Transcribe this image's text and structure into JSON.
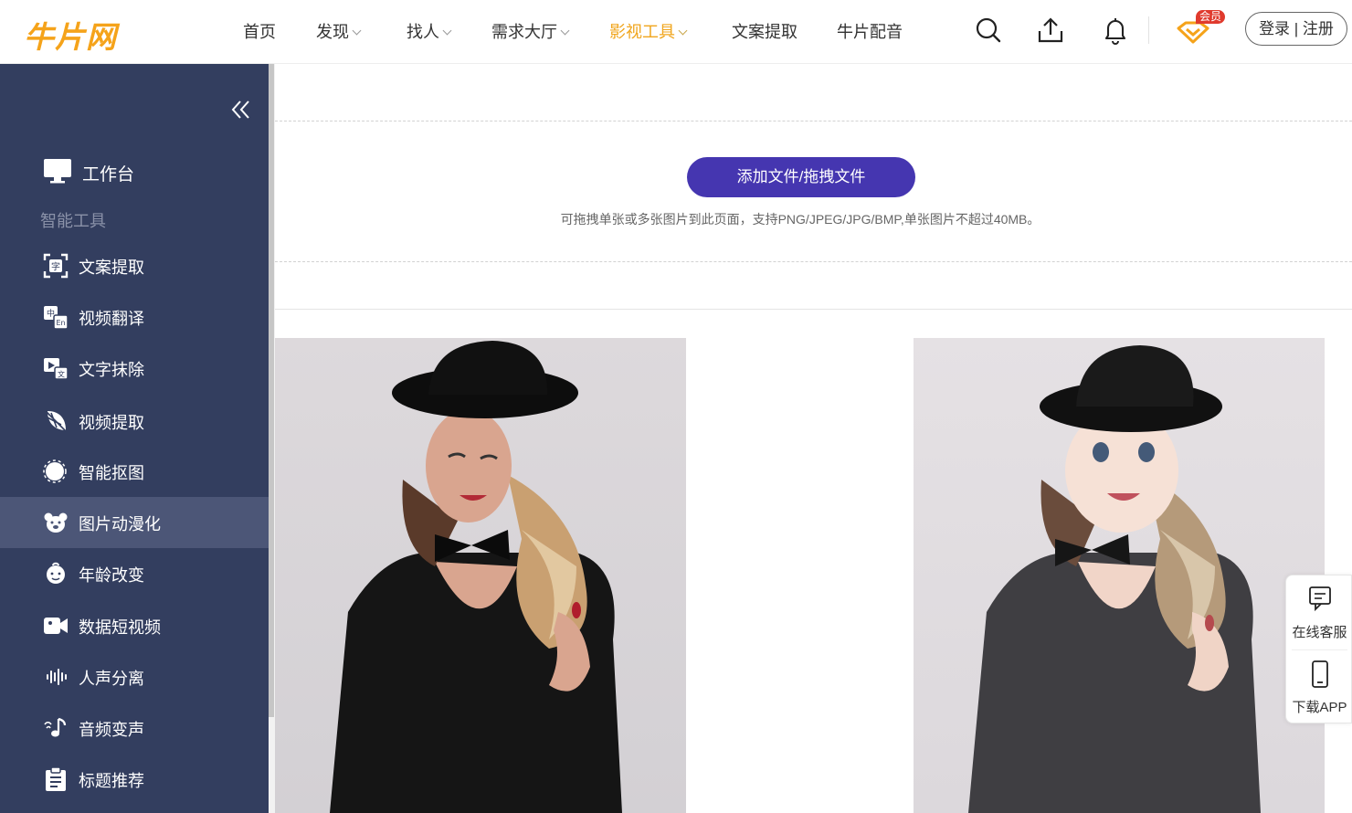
{
  "header": {
    "logo": "牛片网",
    "nav": [
      {
        "label": "首页",
        "dropdown": false,
        "active": false
      },
      {
        "label": "发现",
        "dropdown": true,
        "active": false
      },
      {
        "label": "找人",
        "dropdown": true,
        "active": false
      },
      {
        "label": "需求大厅",
        "dropdown": true,
        "active": false
      },
      {
        "label": "影视工具",
        "dropdown": true,
        "active": true
      },
      {
        "label": "文案提取",
        "dropdown": false,
        "active": false
      },
      {
        "label": "牛片配音",
        "dropdown": false,
        "active": false
      }
    ],
    "icons": [
      "search-icon",
      "upload-icon",
      "bell-icon",
      "vip-icon"
    ],
    "vip_badge": "会员",
    "login_label": "登录 | 注册",
    "active_color": "#f0a51d"
  },
  "sidebar": {
    "collapse_icon": "chevrons-left-icon",
    "workbench": {
      "label": "工作台",
      "icon": "monitor-icon"
    },
    "section_title": "智能工具",
    "items": [
      {
        "label": "文案提取",
        "icon": "scan-text-icon",
        "active": false
      },
      {
        "label": "视频翻译",
        "icon": "translate-icon",
        "active": false
      },
      {
        "label": "文字抹除",
        "icon": "erase-text-icon",
        "active": false
      },
      {
        "label": "视频提取",
        "icon": "leaf-icon",
        "active": false
      },
      {
        "label": "智能抠图",
        "icon": "cutout-icon",
        "active": false
      },
      {
        "label": "图片动漫化",
        "icon": "bear-icon",
        "active": true
      },
      {
        "label": "年龄改变",
        "icon": "baby-icon",
        "active": false
      },
      {
        "label": "数据短视频",
        "icon": "video-camera-icon",
        "active": false
      },
      {
        "label": "人声分离",
        "icon": "waveform-icon",
        "active": false
      },
      {
        "label": "音频变声",
        "icon": "music-note-icon",
        "active": false
      },
      {
        "label": "标题推荐",
        "icon": "clipboard-icon",
        "active": false
      }
    ],
    "bg_color": "#333e5f",
    "active_bg": "#4c5677"
  },
  "main": {
    "upload_button": "添加文件/拖拽文件",
    "upload_hint": "可拖拽单张或多张图片到此页面，支持PNG/JPEG/JPG/BMP,单张图片不超过40MB。",
    "button_color": "#4536b0"
  },
  "float_panel": [
    {
      "label": "在线客服",
      "icon": "chat-icon"
    },
    {
      "label": "下载APP",
      "icon": "phone-icon"
    }
  ]
}
